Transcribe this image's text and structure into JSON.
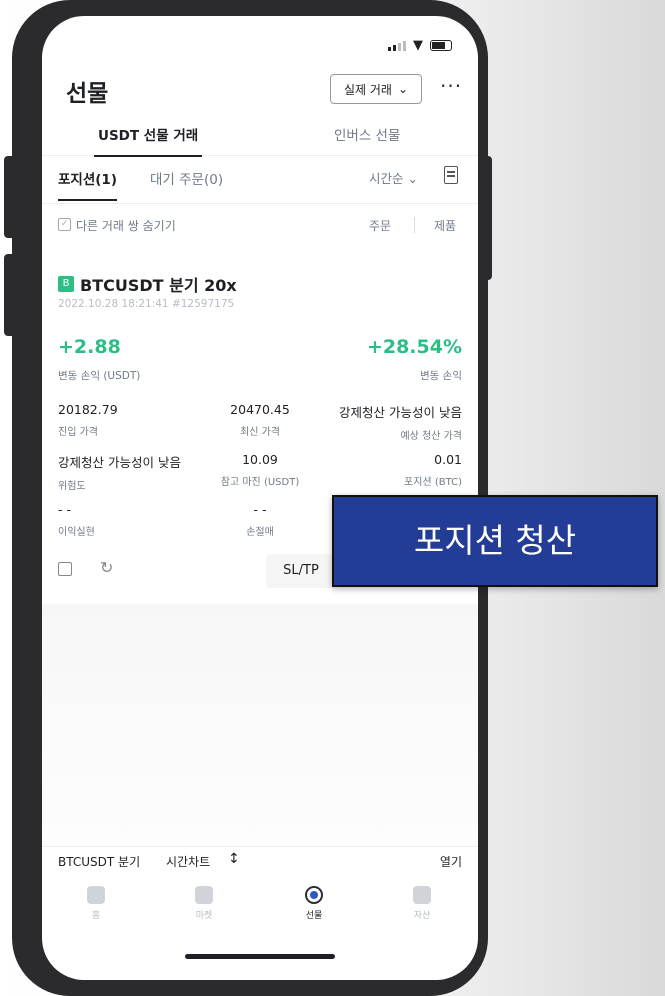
{
  "header": {
    "title": "선물",
    "mode_select": "실제 거래",
    "more": "···"
  },
  "tabs": [
    {
      "label": "USDT 선물 거래"
    },
    {
      "label": "인버스 선물"
    }
  ],
  "subtabs": {
    "positions": "포지션(1)",
    "open_orders": "대기 주문(0)",
    "sort": "시간순"
  },
  "filter": {
    "hide_label": "다른 거래 쌍 숨기기",
    "orders": "주문",
    "close": "제품"
  },
  "position": {
    "badge": "B",
    "symbol": "BTCUSDT 분기 20x",
    "timestamp": "2022.10.28 18:21:41 #12597175",
    "pnl": "+2.88",
    "pnl_label": "변동 손익 (USDT)",
    "roe": "+28.54%",
    "roe_label": "변동 손익",
    "entry_price": "20182.79",
    "entry_price_label": "진입 가격",
    "mark_price": "20470.45",
    "mark_price_label": "최신 가격",
    "liq_price": "강제청산 가능성이 낮음",
    "liq_price_label": "예상 청산 가격",
    "risk": "강제청산 가능성이 낮음",
    "risk_label": "위험도",
    "margin": "10.09",
    "margin_label": "참고 마진 (USDT)",
    "size": "0.01",
    "size_label": "포지션 (BTC)",
    "tp": "- -",
    "tp_label": "이익실현",
    "sl": "- -",
    "sl_label": "손절매",
    "sltp_button": "SL/TP"
  },
  "bottom_bar": {
    "symbol": "BTCUSDT 분기",
    "chart": "시간차트",
    "open": "열기"
  },
  "nav": [
    {
      "label": "홈"
    },
    {
      "label": "마켓"
    },
    {
      "label": "선물"
    },
    {
      "label": "자산"
    }
  ],
  "overlay": {
    "text": "포지션 청산"
  },
  "colors": {
    "profit": "#2ebd85",
    "overlay_bg": "#233d97",
    "text_primary": "#1e2026",
    "text_secondary": "#707a8a"
  }
}
